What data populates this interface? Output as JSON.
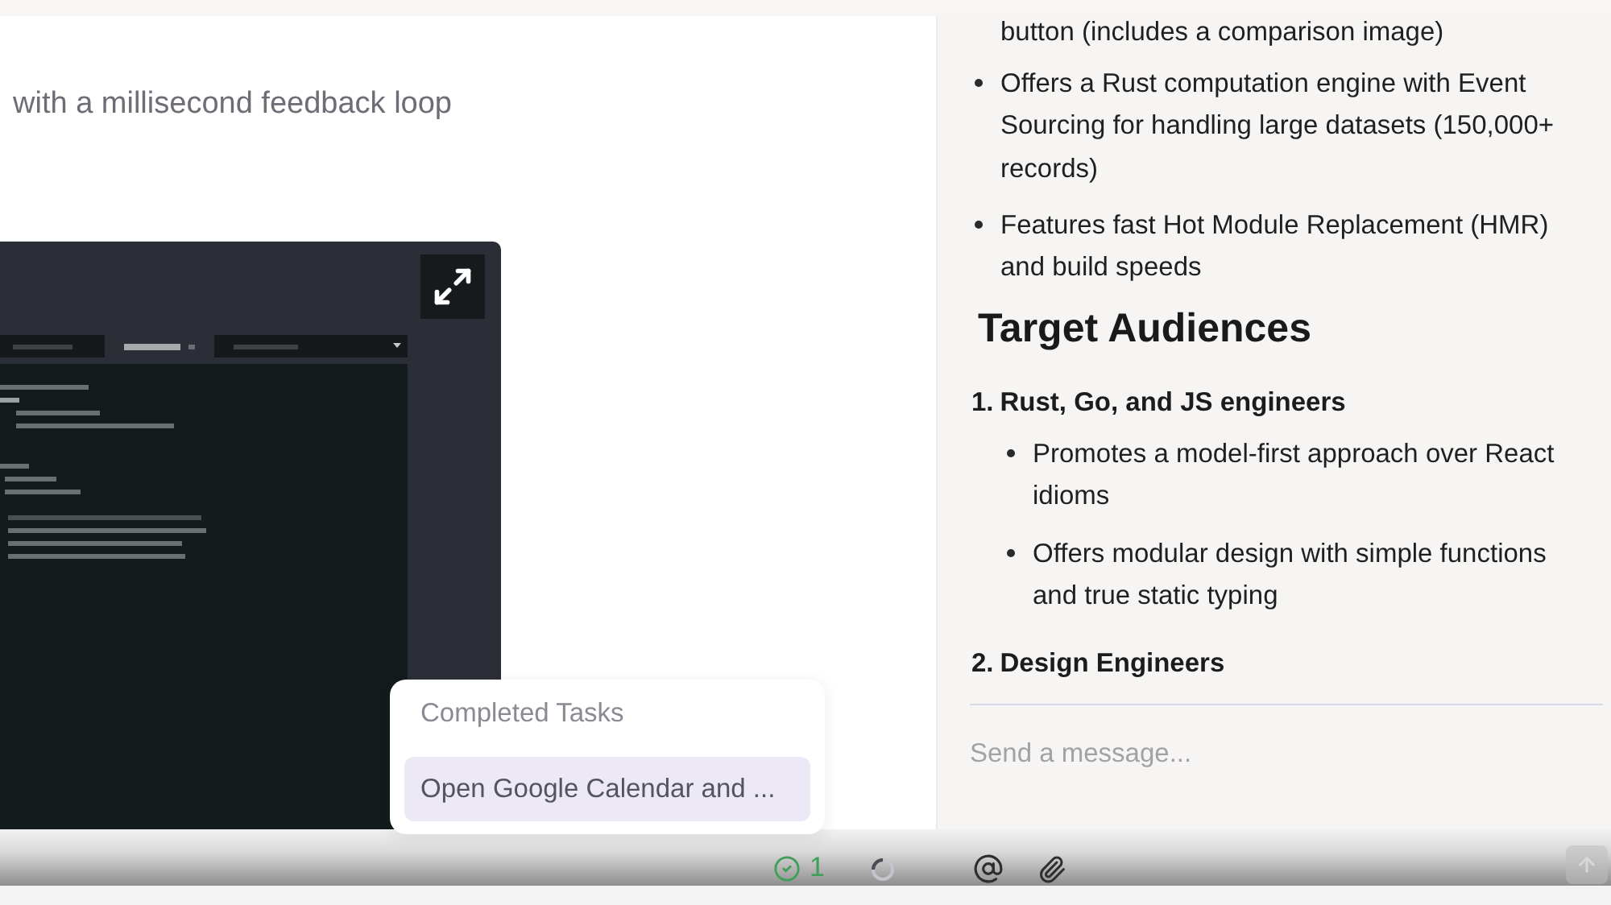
{
  "article": {
    "text": "with a millisecond feedback loop"
  },
  "tasks_popup": {
    "title": "Completed Tasks",
    "items": [
      {
        "label": "Open Google Calendar and ...",
        "selected": true
      }
    ]
  },
  "chat": {
    "blocks": [
      {
        "kind": "continuation",
        "text": "button (includes a comparison image)"
      },
      {
        "kind": "bullet",
        "text": "Offers a Rust computation engine with Event Sourcing for handling large datasets (150,000+ records)"
      },
      {
        "kind": "bullet",
        "text": "Features fast Hot Module Replacement (HMR) and build speeds"
      },
      {
        "kind": "heading",
        "text": "Target Audiences"
      },
      {
        "kind": "numbered",
        "number": "1.",
        "text": "Rust, Go, and JS engineers",
        "children": [
          {
            "kind": "bullet",
            "text": "Promotes a model-first approach over React idioms"
          },
          {
            "kind": "bullet",
            "text": "Offers modular design with simple functions and true static typing"
          }
        ]
      },
      {
        "kind": "numbered",
        "number": "2.",
        "text": "Design Engineers"
      }
    ]
  },
  "composer": {
    "placeholder": "Send a message..."
  },
  "status_bar": {
    "completed_count": "1"
  }
}
